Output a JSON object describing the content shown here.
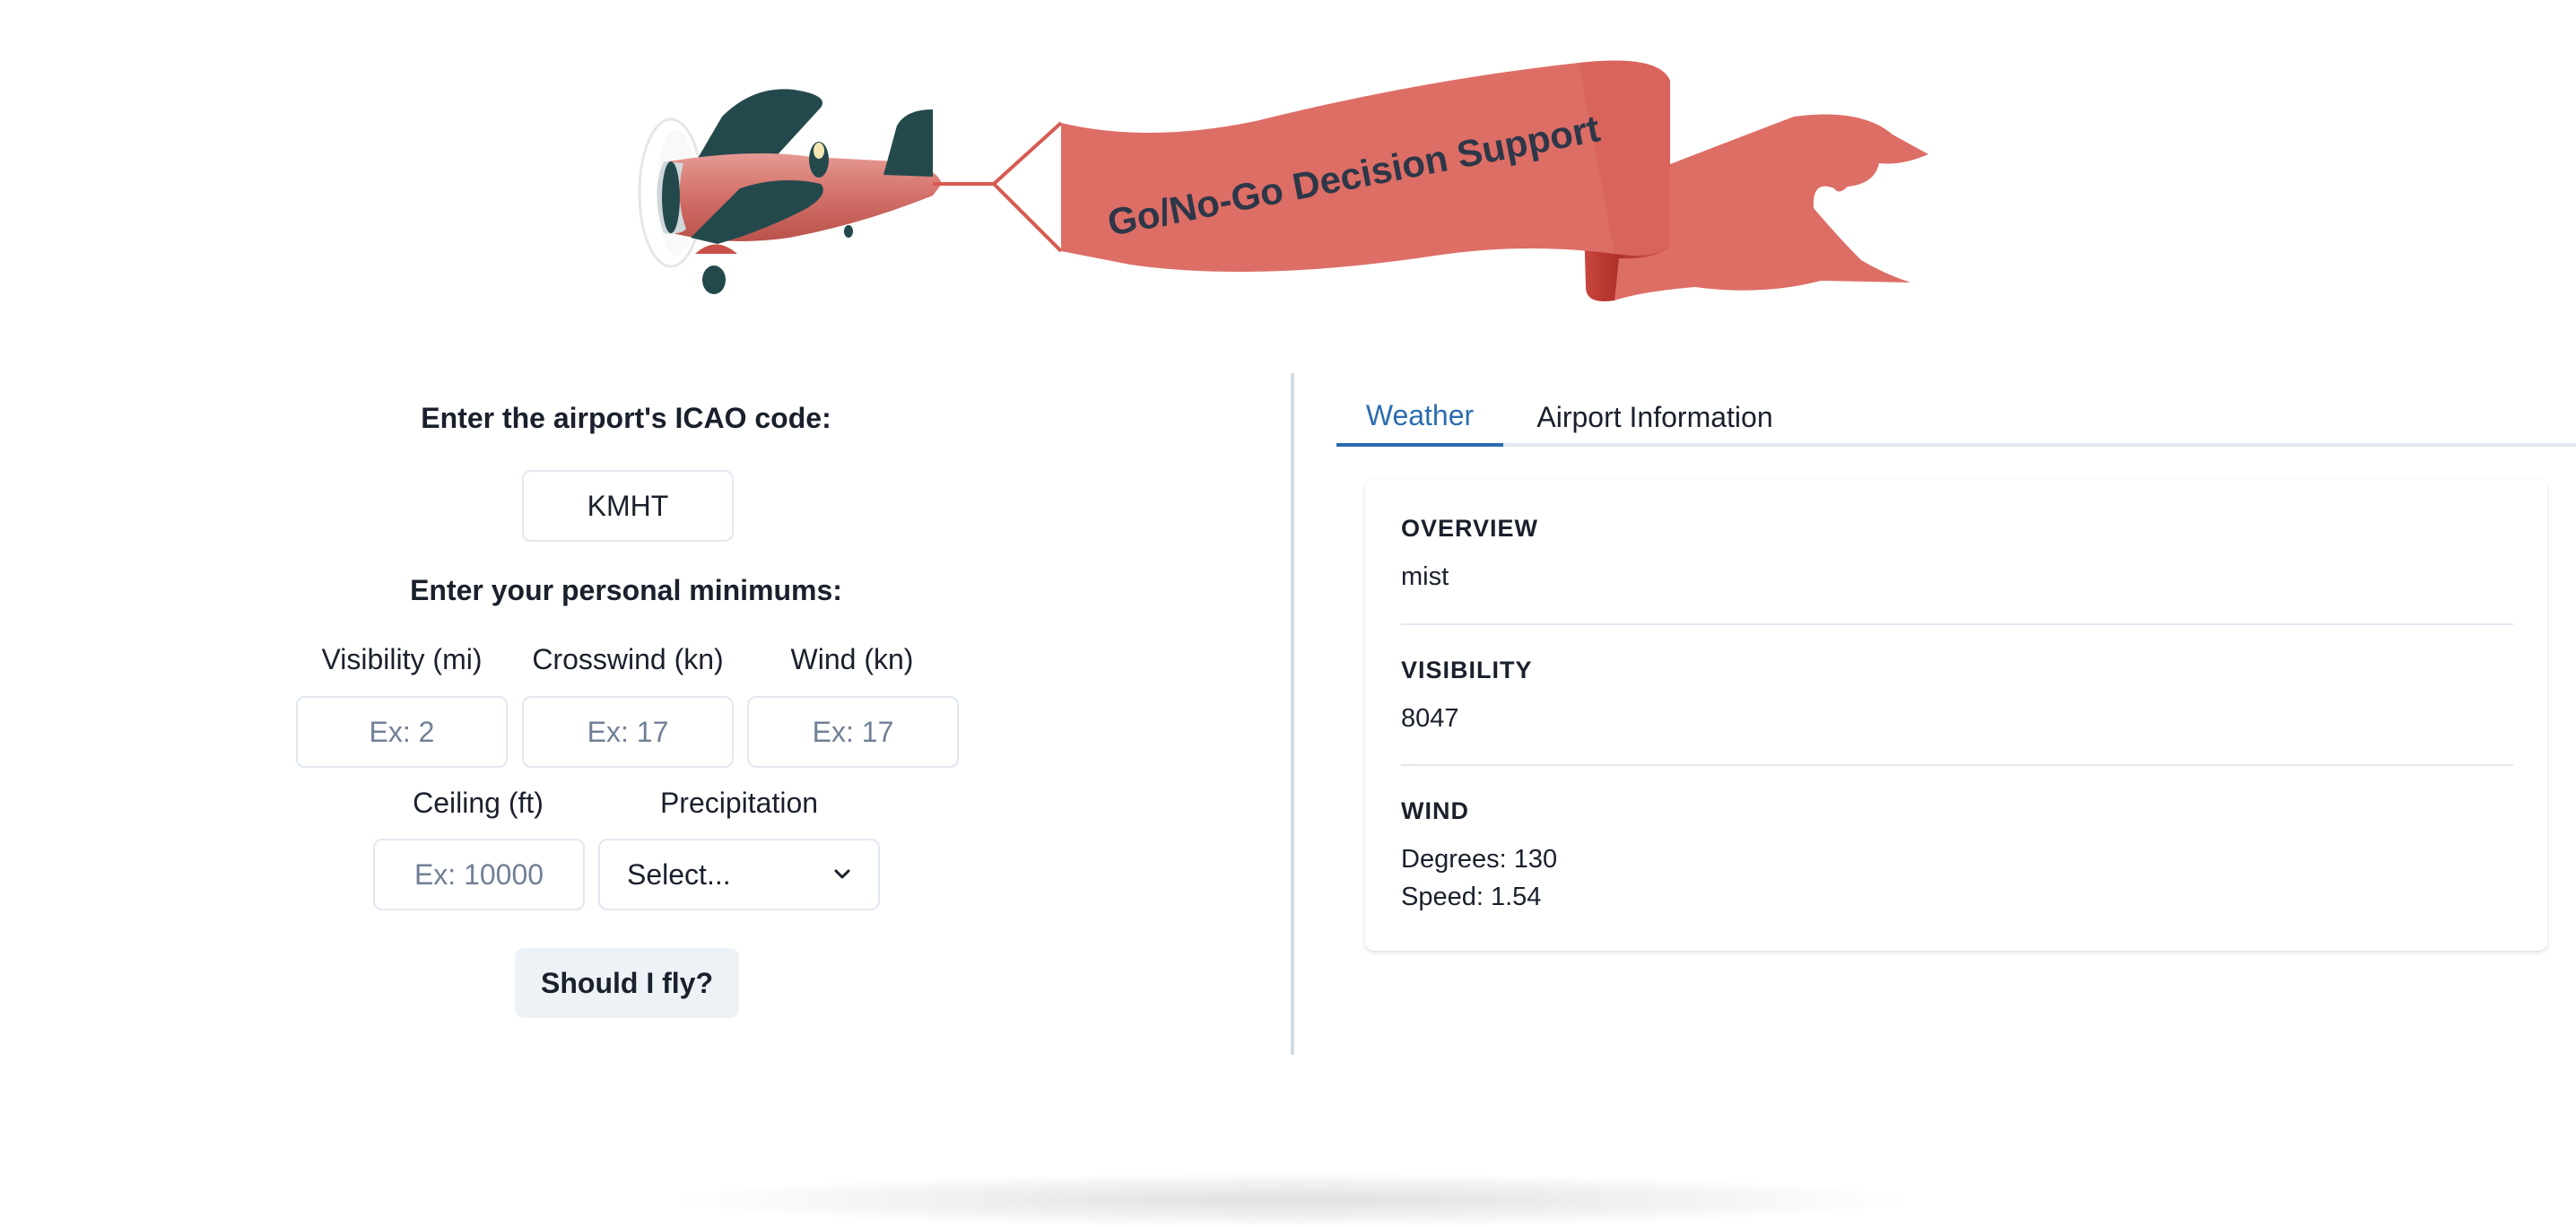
{
  "banner": {
    "text": "Go/No-Go Decision Support"
  },
  "colors": {
    "banner": "#dd6e66",
    "banner_dark": "#b3362e",
    "plane_dark": "#24494d",
    "accent": "#2b6cb0"
  },
  "form": {
    "icao_label": "Enter the airport's ICAO code:",
    "icao_value": "KMHT",
    "minimums_label": "Enter your personal minimums:",
    "visibility_label": "Visibility (mi)",
    "visibility_placeholder": "Ex: 2",
    "crosswind_label": "Crosswind (kn)",
    "crosswind_placeholder": "Ex: 17",
    "wind_label": "Wind (kn)",
    "wind_placeholder": "Ex: 17",
    "ceiling_label": "Ceiling (ft)",
    "ceiling_placeholder": "Ex: 10000",
    "precip_label": "Precipitation",
    "precip_selected": "Select...",
    "submit_label": "Should I fly?"
  },
  "tabs": [
    {
      "label": "Weather",
      "active": true
    },
    {
      "label": "Airport Information",
      "active": false
    }
  ],
  "weather": {
    "overview_title": "OVERVIEW",
    "overview_value": "mist",
    "visibility_title": "VISIBILITY",
    "visibility_value": "8047",
    "wind_title": "WIND",
    "wind_degrees": "Degrees: 130",
    "wind_speed": "Speed: 1.54"
  }
}
